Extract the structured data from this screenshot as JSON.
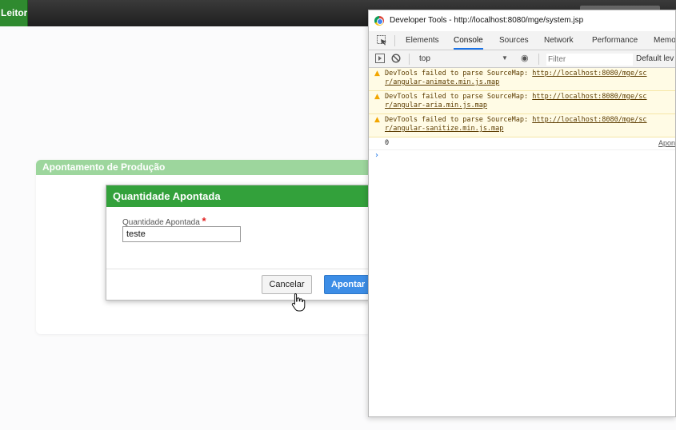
{
  "topbar": {
    "button_label": "Leitor"
  },
  "panel": {
    "title": "Apontamento de Produção"
  },
  "modal": {
    "title": "Quantidade Apontada",
    "field_label": "Quantidade Apontada",
    "required_mark": "*",
    "field_value": "teste",
    "cancel_label": "Cancelar",
    "ok_label": "Apontar"
  },
  "devtools": {
    "window_title": "Developer Tools - http://localhost:8080/mge/system.jsp",
    "tabs": [
      "Elements",
      "Console",
      "Sources",
      "Network",
      "Performance",
      "Memo"
    ],
    "active_tab": "Console",
    "context": "top",
    "filter_placeholder": "Filter",
    "levels": "Default lev",
    "warnings": [
      {
        "text": "DevTools failed to parse SourceMap: ",
        "url1": "http://localhost:8080/mge/sc",
        "url2": "r/angular-animate.min.js.map"
      },
      {
        "text": "DevTools failed to parse SourceMap: ",
        "url1": "http://localhost:8080/mge/sc",
        "url2": "r/angular-aria.min.js.map"
      },
      {
        "text": "DevTools failed to parse SourceMap: ",
        "url1": "http://localhost:8080/mge/sc",
        "url2": "r/angular-sanitize.min.js.map"
      }
    ],
    "log": {
      "value": "0",
      "source": "Apon"
    },
    "prompt_symbol": "›"
  }
}
